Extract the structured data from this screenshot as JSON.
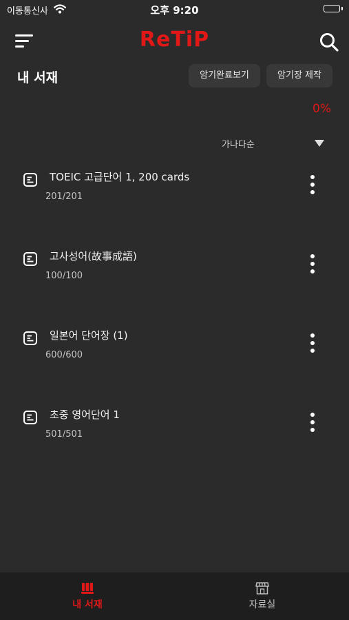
{
  "status": {
    "carrier": "이동통신사",
    "time": "오후 9:20"
  },
  "header": {
    "logo": "ReTiP"
  },
  "shelf": {
    "title": "내 서재",
    "buttons": {
      "done_view": "암기완료보기",
      "make": "암기장 제작"
    },
    "progress": "0%",
    "sort": {
      "label": "가나다순"
    }
  },
  "items": [
    {
      "title": "TOEIC 고급단어 1,  200 cards",
      "count": "201/201"
    },
    {
      "title": "고사성어(故事成語)",
      "count": "100/100"
    },
    {
      "title": "일본어 단어장 (1)",
      "count": "600/600"
    },
    {
      "title": "초중 영어단어 1",
      "count": "501/501"
    }
  ],
  "tabbar": {
    "shelf": "내 서재",
    "library": "자료실"
  },
  "colors": {
    "accent": "#e01818",
    "background": "#2b2b2b",
    "tabbar": "#1e1e1e"
  },
  "icons": [
    "wifi-icon",
    "battery-icon",
    "menu-icon",
    "search-icon",
    "document-icon",
    "more-vertical-icon",
    "bookshelf-icon",
    "store-icon",
    "sort-triangle-icon"
  ]
}
